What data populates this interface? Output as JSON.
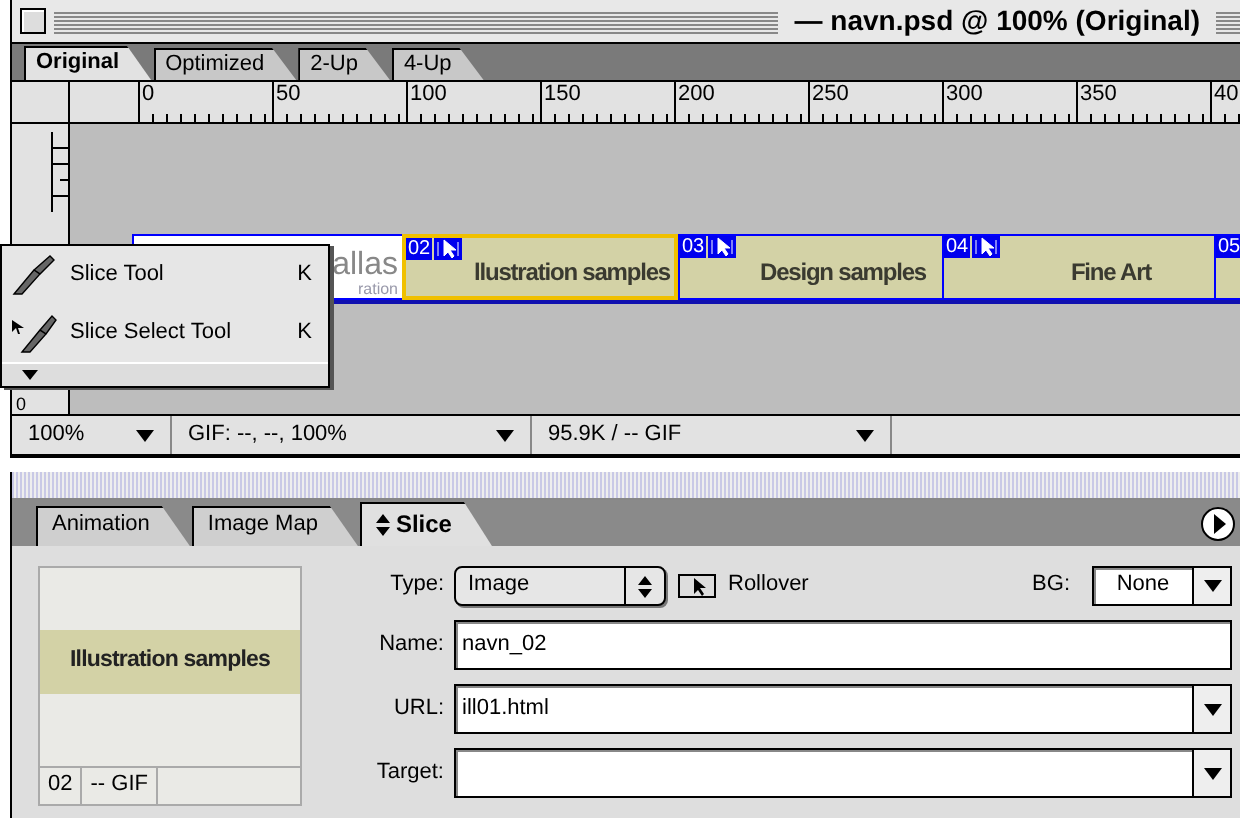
{
  "window": {
    "title": "— navn.psd @ 100% (Original)"
  },
  "view_tabs": [
    {
      "label": "Original",
      "selected": true
    },
    {
      "label": "Optimized",
      "selected": false
    },
    {
      "label": "2-Up",
      "selected": false
    },
    {
      "label": "4-Up",
      "selected": false
    }
  ],
  "ruler": {
    "labels": [
      "0",
      "50",
      "100",
      "150",
      "200",
      "250",
      "300",
      "350",
      "40"
    ]
  },
  "vertical_ruler": {
    "label": "0"
  },
  "slices": [
    {
      "kind": "logo",
      "texts": [
        "allas",
        "ration"
      ],
      "selected": false
    },
    {
      "kind": "button",
      "number": "02",
      "label": "llustration samples",
      "selected": true
    },
    {
      "kind": "button",
      "number": "03",
      "label": "Design samples",
      "selected": false
    },
    {
      "kind": "button",
      "number": "04",
      "label": "Fine Art",
      "selected": false
    },
    {
      "kind": "cut",
      "number": "05",
      "selected": false
    }
  ],
  "tool_menu": {
    "items": [
      {
        "label": "Slice Tool",
        "shortcut": "K",
        "kind": "slice"
      },
      {
        "label": "Slice Select Tool",
        "shortcut": "K",
        "kind": "select"
      }
    ]
  },
  "status_bar": {
    "zoom": "100%",
    "format": "GIF: --, --, 100%",
    "size": "95.9K / -- GIF"
  },
  "panel_tabs": [
    {
      "label": "Animation",
      "selected": false
    },
    {
      "label": "Image Map",
      "selected": false
    },
    {
      "label": "Slice",
      "selected": true
    }
  ],
  "slice_panel": {
    "preview": {
      "label": "Illustration samples",
      "number": "02",
      "format": "-- GIF"
    },
    "type": {
      "label": "Type:",
      "value": "Image"
    },
    "rollover": {
      "label": "Rollover"
    },
    "bg": {
      "label": "BG:",
      "value": "None"
    },
    "name": {
      "label": "Name:",
      "value": "navn_02"
    },
    "url": {
      "label": "URL:",
      "value": "ill01.html"
    },
    "target": {
      "label": "Target:"
    }
  }
}
